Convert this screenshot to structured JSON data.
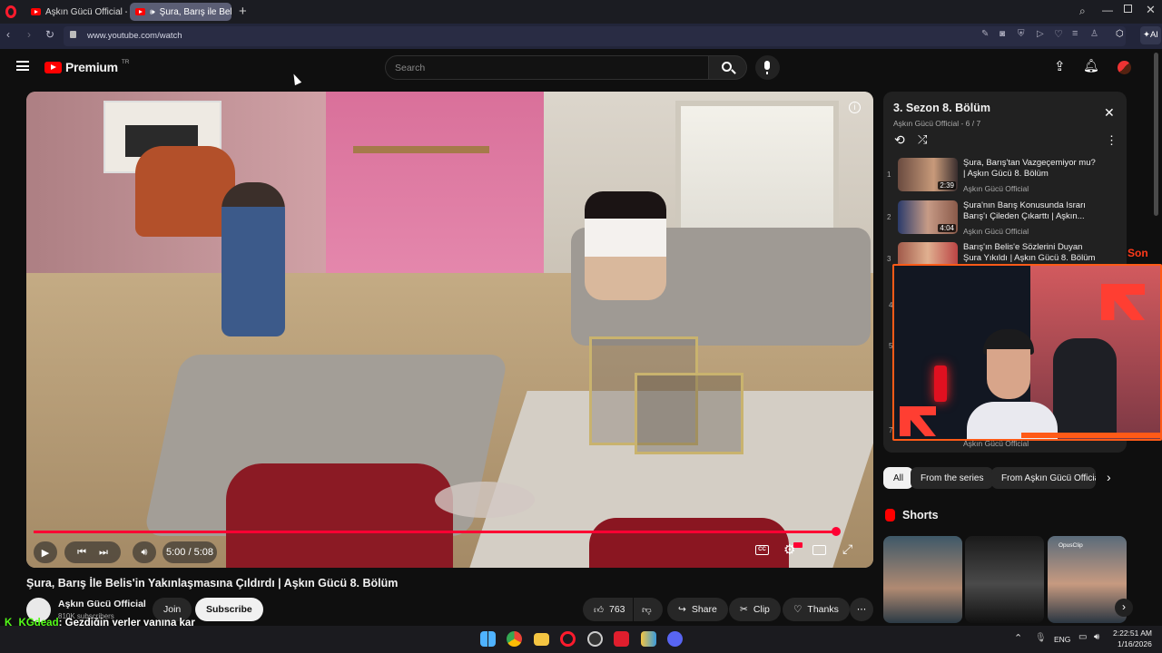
{
  "browser": {
    "tabs": [
      {
        "label": "Aşkın Gücü Official - YouT"
      },
      {
        "label": "Şura, Barış ile Belis'in Y"
      }
    ],
    "url": "www.youtube.com/watch",
    "ai_label": "AI",
    "accent": "#ff1b2d"
  },
  "header": {
    "logo_text": "Premium",
    "country": "TR",
    "search_placeholder": "Search"
  },
  "player": {
    "time": "5:00 / 5:08",
    "progress": 0.99
  },
  "video": {
    "title": "Şura, Barış İle Belis'in Yakınlaşmasına Çıldırdı | Aşkın Gücü 8. Bölüm",
    "channel": "Aşkın Gücü Official",
    "subscribers": "810K subscribers",
    "join_label": "Join",
    "subscribe_label": "Subscribe",
    "likes": "763",
    "share_label": "Share",
    "clip_label": "Clip",
    "thanks_label": "Thanks"
  },
  "playlist": {
    "title": "3. Sezon 8. Bölüm",
    "subtitle": "Aşkın Gücü Official - 6 / 7",
    "items": [
      {
        "num": "1",
        "title": "Şura, Barış'tan Vazgeçemiyor mu? | Aşkın Gücü 8. Bölüm",
        "channel": "Aşkın Gücü Official",
        "duration": "2:39"
      },
      {
        "num": "2",
        "title": "Şura'nın Barış Konusunda Israrı Barış'ı Çileden Çıkarttı | Aşkın...",
        "channel": "Aşkın Gücü Official",
        "duration": "4:04"
      },
      {
        "num": "3",
        "title": "Barış'ın Belis'e Sözlerini Duyan Şura Yıkıldı | Aşkın Gücü 8. Bölüm",
        "channel": "",
        "duration": ""
      }
    ],
    "hidden_nums": [
      "4",
      "5",
      "7"
    ],
    "last_channel": "Aşkın Gücü Official"
  },
  "overlay": {
    "son_text": "Son"
  },
  "filters": [
    "All",
    "From the series",
    "From Aşkın Gücü Official"
  ],
  "shorts": {
    "heading": "Shorts",
    "third_badge": "OpusClip"
  },
  "chat": {
    "user": "KGdead",
    "message": ": Gezdiğin yerler yanına kar"
  },
  "taskbar": {
    "lang": "ENG",
    "time": "2:22:51 AM",
    "date": "1/16/2026"
  }
}
